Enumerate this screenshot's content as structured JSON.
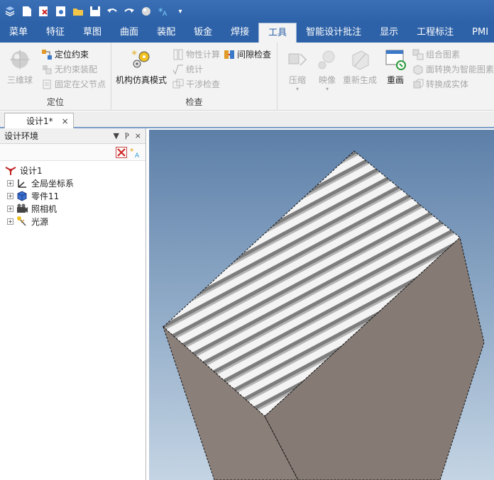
{
  "qat": {
    "icons": [
      "app-logo-icon",
      "new-icon",
      "save-as-icon",
      "import-icon",
      "open-icon",
      "save-icon",
      "undo-icon",
      "redo-icon",
      "render-icon",
      "smart-icon",
      "dropdown-icon"
    ]
  },
  "tabs": [
    "菜单",
    "特征",
    "草图",
    "曲面",
    "装配",
    "钣金",
    "焊接",
    "工具",
    "智能设计批注",
    "显示",
    "工程标注",
    "PMI"
  ],
  "active_tab": "工具",
  "ribbon": {
    "position_group": {
      "label": "定位",
      "ball_label": "三维球",
      "locate_constraint": "定位约束",
      "unconstrained_assembly": "无约束装配",
      "fix_parent": "固定在父节点"
    },
    "check_group": {
      "label": "检查",
      "mechanism_sim": "机构仿真模式",
      "property_calc": "物性计算",
      "gap_check": "间隙检查",
      "statistics": "统计",
      "interference_check": "干涉检查"
    },
    "tools_group": {
      "compress": "压缩",
      "map": "映像",
      "regenerate": "重新生成",
      "redraw": "重画",
      "combine_figure": "组合图素",
      "face_to_smart": "面转换为智能图素",
      "convert_solid": "转换成实体"
    }
  },
  "doc_tab": {
    "label": "设计1*",
    "close": "×"
  },
  "panel": {
    "title": "设计环境",
    "controls": [
      "▼",
      "Ⲣ",
      "×"
    ],
    "tree": {
      "root": "设计1",
      "items": [
        "全局坐标系",
        "零件11",
        "照相机",
        "光源"
      ]
    }
  },
  "colors": {
    "ribbon_blue": "#2e62a8",
    "viewport_top": "#5d7fa8",
    "box_side": "#8a7f7a"
  }
}
